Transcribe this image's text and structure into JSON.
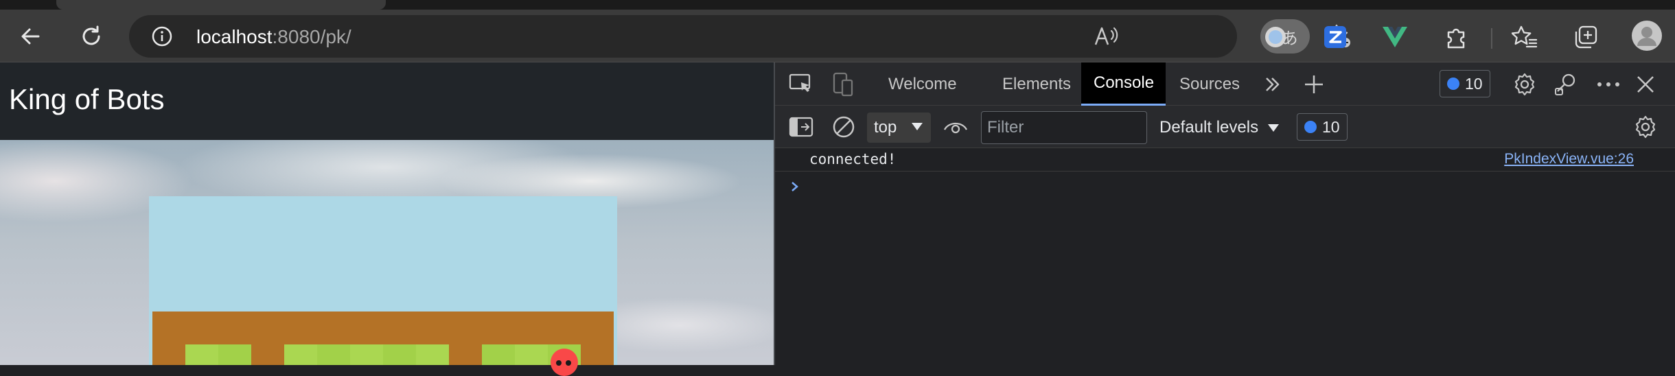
{
  "browser": {
    "url_host": "localhost",
    "url_rest": ":8080/pk/",
    "translate_label": "aあ"
  },
  "page": {
    "navbar_brand": "King of Bots"
  },
  "devtools": {
    "tabs": [
      {
        "label": "Welcome"
      },
      {
        "label": "Elements"
      },
      {
        "label": "Console"
      },
      {
        "label": "Sources"
      }
    ],
    "active_tab": "Console",
    "issues_count": "10",
    "context": "top",
    "filter_placeholder": "Filter",
    "levels_label": "Default levels",
    "messages_count": "10",
    "console_message": "connected!",
    "console_source": "PkIndexView.vue:26"
  },
  "colors": {
    "accent": "#7cacf8",
    "game_panel": "#add8e6",
    "map_wall": "#b47226",
    "grass_light": "#aad751",
    "grass_dark": "#a2d149",
    "snake_red": "#f94848"
  }
}
